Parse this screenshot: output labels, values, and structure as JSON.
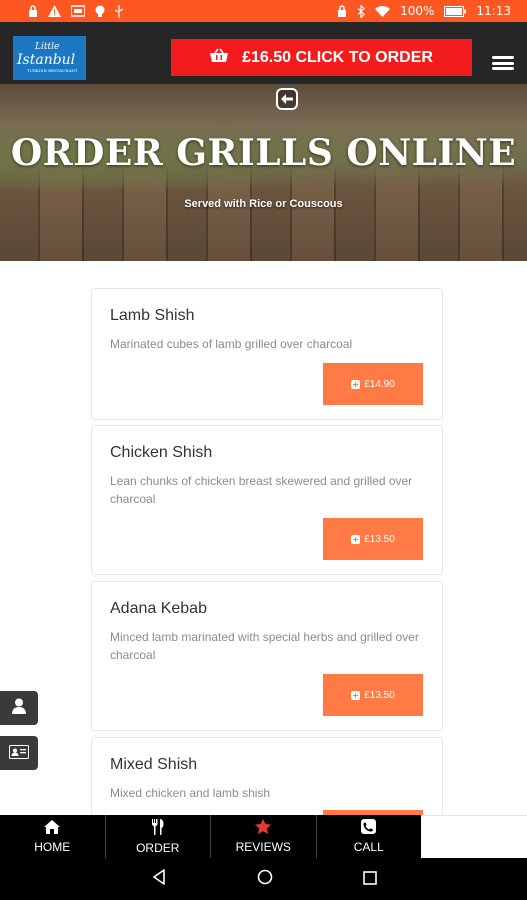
{
  "status_bar": {
    "battery": "100%",
    "time": "11:13"
  },
  "header": {
    "logo": {
      "line1": "Little",
      "line2": "Istanbul",
      "line3": "TURKISH RESTAURANT"
    },
    "order_button_label": "£16.50 CLICK TO ORDER"
  },
  "hero": {
    "title": "ORDER GRILLS ONLINE",
    "subtitle": "Served with Rice or Couscous"
  },
  "menu_items": [
    {
      "name": "Lamb Shish",
      "description": "Marinated cubes of lamb grilled over charcoal",
      "price": "£14.90"
    },
    {
      "name": "Chicken Shish",
      "description": "Lean chunks of chicken breast skewered and grilled over charcoal",
      "price": "£13.50"
    },
    {
      "name": "Adana Kebab",
      "description": "Minced lamb marinated with special herbs and grilled over charcoal",
      "price": "£13.50"
    },
    {
      "name": "Mixed Shish",
      "description": "Mixed chicken and lamb shish",
      "price": ""
    }
  ],
  "bottom_nav": [
    {
      "label": "HOME",
      "icon": "home-icon"
    },
    {
      "label": "ORDER",
      "icon": "cutlery-icon"
    },
    {
      "label": "REVIEWS",
      "icon": "star-icon"
    },
    {
      "label": "CALL",
      "icon": "phone-icon"
    }
  ],
  "colors": {
    "status_bar": "#ff5722",
    "header": "#262626",
    "order_button": "#f21c1c",
    "price_button": "#ff7a45",
    "reviews_star": "#e53935"
  }
}
